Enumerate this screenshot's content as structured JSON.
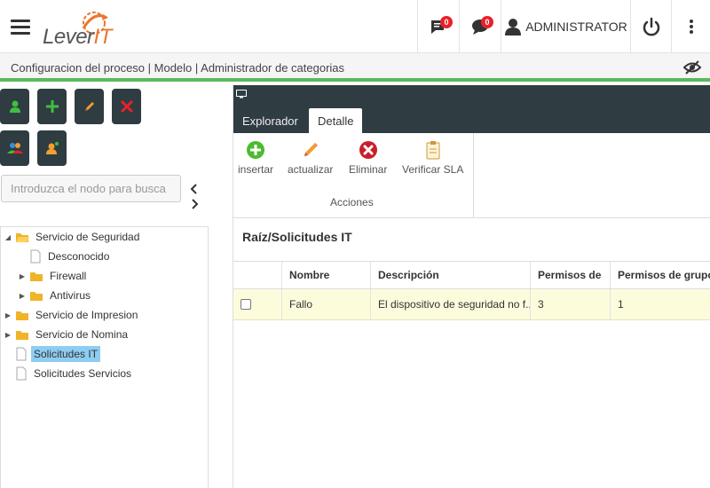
{
  "header": {
    "logo_text": "Lever",
    "logo_accent": "IT",
    "notifications_count": "0",
    "messages_count": "0",
    "user": "ADMINISTRATOR"
  },
  "breadcrumb": "Configuracion del proceso | Modelo | Administrador de categorias",
  "search": {
    "placeholder": "Introduzca el nodo para busca"
  },
  "tree": [
    {
      "label": "Servicio de Seguridad",
      "type": "folder-open",
      "expanded": true
    },
    {
      "label": "Desconocido",
      "type": "file"
    },
    {
      "label": "Firewall",
      "type": "folder"
    },
    {
      "label": "Antivirus",
      "type": "folder"
    },
    {
      "label": "Servicio de Impresion",
      "type": "folder"
    },
    {
      "label": "Servicio de Nomina",
      "type": "folder"
    },
    {
      "label": "Solicitudes IT",
      "type": "file",
      "selected": true
    },
    {
      "label": "Solicitudes Servicios",
      "type": "file"
    }
  ],
  "tabs": [
    "Explorador",
    "Detalle"
  ],
  "active_tab": "Detalle",
  "actions": {
    "insert": "insertar",
    "update": "actualizar",
    "delete": "Eliminar",
    "sla": "Verificar SLA",
    "group": "Acciones"
  },
  "section_title": "Raíz/Solicitudes IT",
  "table": {
    "columns": [
      "",
      "Nombre",
      "Descripción",
      "Permisos de",
      "Permisos de grupo"
    ],
    "rows": [
      {
        "checked": false,
        "nombre": "Fallo",
        "descripcion": "El dispositivo de seguridad no f...",
        "permisos": "3",
        "permisos_grupo": "1"
      }
    ]
  },
  "colors": {
    "dark": "#2f3c42",
    "accent_green": "#5cb85c",
    "selection": "#8ecdf1",
    "row_highlight": "#fcfbdc",
    "badge": "#e8212a"
  }
}
